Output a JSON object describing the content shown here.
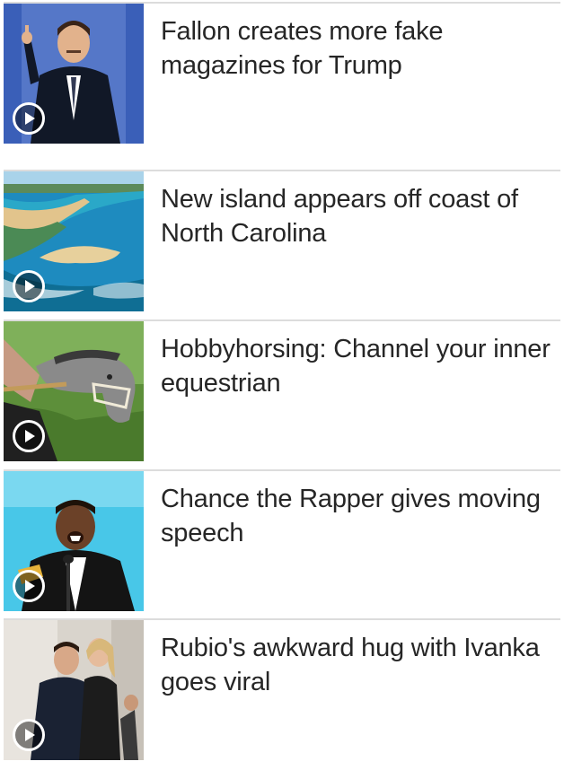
{
  "colors": {
    "divider": "#dcdcdc",
    "headline_text": "#262626",
    "play_icon": "#ffffff"
  },
  "video_items": [
    {
      "headline": "Fallon creates more fake magazines for Trump",
      "icon": "play-circle-icon"
    },
    {
      "headline": "New island appears off coast of North Carolina",
      "icon": "play-circle-icon"
    },
    {
      "headline": "Hobbyhorsing: Channel your inner equestrian",
      "icon": "play-circle-icon"
    },
    {
      "headline": "Chance the Rapper gives moving speech",
      "icon": "play-circle-icon"
    },
    {
      "headline": "Rubio's awkward hug with Ivanka goes viral",
      "icon": "play-circle-icon"
    }
  ]
}
